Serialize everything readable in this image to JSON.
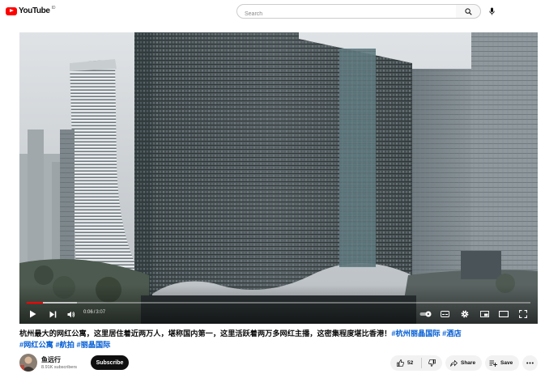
{
  "header": {
    "logo_text": "YouTube",
    "logo_country": "ID",
    "search_placeholder": "Search",
    "brand_color": "#ff0000"
  },
  "player": {
    "current_time": "0:06",
    "time_separator": "/",
    "duration": "3:07",
    "progress_fraction": 0.032,
    "buffered_fraction": 0.1,
    "progress_color": "#ff0000"
  },
  "video": {
    "title": "杭州最大的网红公寓，这里居住着近两万人，堪称国内第一，这里活跃着两万多网红主播，这密集程度堪比香港！",
    "hashtags_inline": [
      "#杭州丽晶国际",
      "#酒店"
    ],
    "hashtags_line2": [
      "#网红公寓",
      "#航拍",
      "#丽晶国际"
    ],
    "link_color": "#065fd4"
  },
  "channel": {
    "name": "鱼远行",
    "subscribers": "8.91K subscribers",
    "subscribe_label": "Subscribe"
  },
  "actions": {
    "like_count": "52",
    "share_label": "Share",
    "save_label": "Save"
  },
  "icons": [
    "youtube-logo-icon",
    "search-icon",
    "mic-icon",
    "play-icon",
    "next-icon",
    "volume-icon",
    "autoplay-toggle-icon",
    "captions-icon",
    "settings-icon",
    "miniplayer-icon",
    "theater-icon",
    "fullscreen-icon",
    "like-icon",
    "dislike-icon",
    "share-icon",
    "save-icon",
    "more-icon"
  ]
}
